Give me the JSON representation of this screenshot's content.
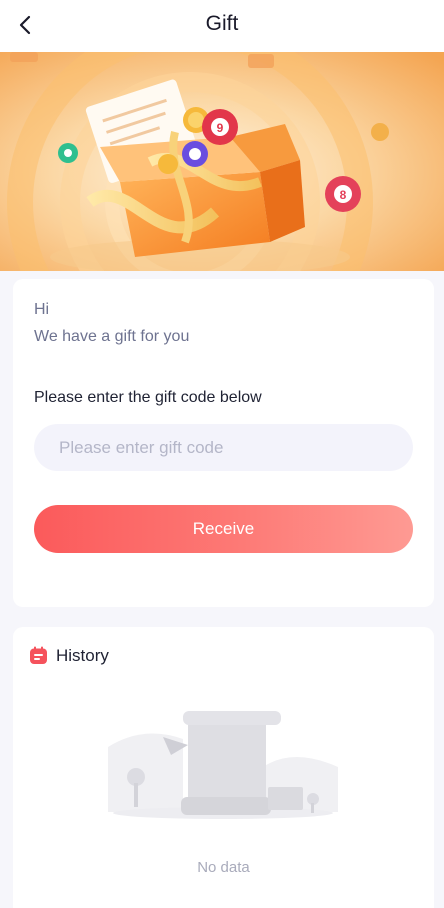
{
  "header": {
    "title": "Gift"
  },
  "greeting": {
    "hi": "Hi",
    "message": "We have a gift for you"
  },
  "form": {
    "label": "Please enter the gift code below",
    "code_value": "",
    "code_placeholder": "Please enter gift code",
    "receive_label": "Receive"
  },
  "history": {
    "title": "History",
    "empty_text": "No data"
  },
  "icons": {
    "back": "chevron-left-icon",
    "history": "calendar-icon",
    "banner": "gift-box-illustration",
    "empty": "empty-scroll-illustration"
  },
  "colors": {
    "accent_start": "#fb5a5b",
    "accent_end": "#fe9a93",
    "banner_orange": "#f7a64a",
    "background": "#f6f6fb"
  }
}
